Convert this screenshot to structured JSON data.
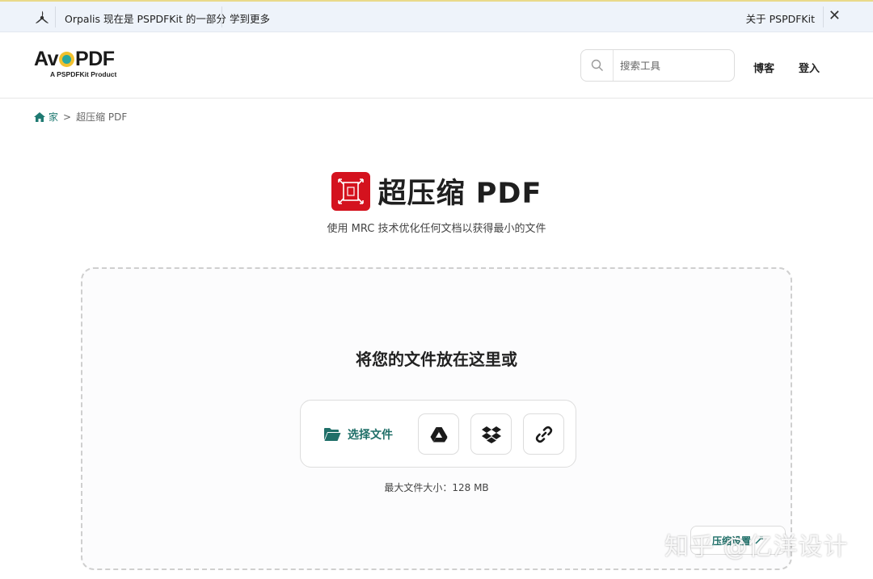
{
  "topbar": {
    "message": "Orpalis 现在是 PSPDFKit 的一部分",
    "learn_more": "学到更多",
    "about": "关于 PSPDFKit",
    "close_symbol": "✕"
  },
  "header": {
    "brand_name_pre": "Av",
    "brand_name_post": "PDF",
    "brand_sub": "A PSPDFKit Product",
    "search_placeholder": "搜索工具",
    "nav": {
      "blog": "博客",
      "login": "登入"
    }
  },
  "breadcrumb": {
    "home": "家",
    "separator": ">",
    "current": "超压缩 PDF"
  },
  "tool": {
    "title": "超压缩 PDF",
    "subtitle": "使用 MRC 技术优化任何文档以获得最小的文件",
    "icon_color": "#d4121e"
  },
  "dropzone": {
    "title": "将您的文件放在这里或",
    "choose_label": "选择文件",
    "sources": [
      {
        "icon": "google-drive-icon"
      },
      {
        "icon": "dropbox-icon"
      },
      {
        "icon": "link-icon"
      }
    ],
    "max_size": "最大文件大小：128 MB",
    "advanced_label": "压缩设置"
  },
  "watermark": "知乎 @亿洋设计",
  "colors": {
    "accent": "#1f6f68",
    "topbar_bg": "#eef3fa"
  }
}
